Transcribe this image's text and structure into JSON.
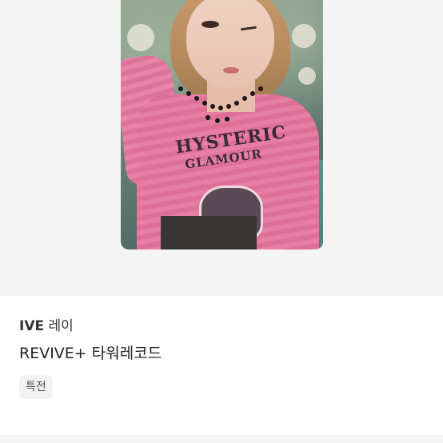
{
  "product": {
    "image_alt": "IVE 레이 photocard",
    "artist_group": "IVE",
    "artist_member": "레이",
    "title": "REVIVE+ 타워레코드",
    "tag": "특전"
  },
  "photocard": {
    "print_line1": "HYSTERIC",
    "print_line2": "GLAMOUR"
  }
}
